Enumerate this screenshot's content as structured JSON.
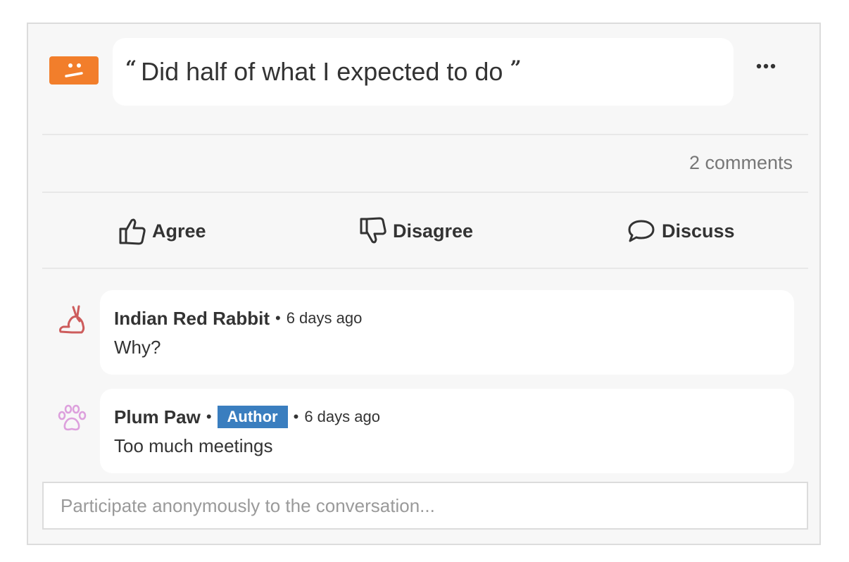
{
  "feedback": {
    "quote": "Did half of what I expected to do",
    "mood_icon": "neutral-face-icon",
    "mood_color": "#f27e2b"
  },
  "stats": {
    "comments_label": "2 comments"
  },
  "actions": {
    "agree_label": "Agree",
    "disagree_label": "Disagree",
    "discuss_label": "Discuss"
  },
  "comments": [
    {
      "author": "Indian Red Rabbit",
      "time": "6 days ago",
      "text": "Why?",
      "avatar": "rabbit-icon",
      "avatar_color": "#cd5c5c"
    },
    {
      "author": "Plum Paw",
      "badge": "Author",
      "time": "6 days ago",
      "text": "Too much meetings",
      "avatar": "paw-icon",
      "avatar_color": "#dda0dd"
    }
  ],
  "composer": {
    "placeholder": "Participate anonymously to the conversation..."
  },
  "colors": {
    "badge": "#3a7ebf",
    "card_bg": "#f7f7f7"
  }
}
